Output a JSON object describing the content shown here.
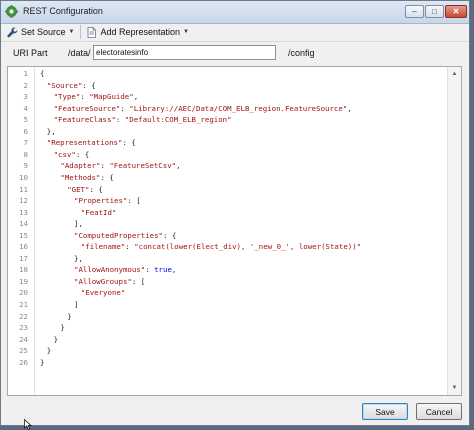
{
  "window": {
    "title": "REST Configuration",
    "controls": {
      "minimize": "–",
      "maximize": "□",
      "close": "✕"
    }
  },
  "toolbar": {
    "set_source_label": "Set Source",
    "add_representation_label": "Add Representation"
  },
  "uri": {
    "label": "URI Part",
    "prefix": "/data/",
    "value": "electoratesinfo",
    "suffix": "/config"
  },
  "editor": {
    "lines": [
      {
        "n": "1",
        "indent": 0,
        "parts": [
          {
            "t": "{",
            "c": "punc"
          }
        ]
      },
      {
        "n": "2",
        "indent": 1,
        "parts": [
          {
            "t": "\"Source\"",
            "c": "key"
          },
          {
            "t": ": {",
            "c": "punc"
          }
        ]
      },
      {
        "n": "3",
        "indent": 2,
        "parts": [
          {
            "t": "\"Type\"",
            "c": "key"
          },
          {
            "t": ": ",
            "c": "punc"
          },
          {
            "t": "\"MapGuide\"",
            "c": "str"
          },
          {
            "t": ",",
            "c": "punc"
          }
        ]
      },
      {
        "n": "4",
        "indent": 2,
        "parts": [
          {
            "t": "\"FeatureSource\"",
            "c": "key"
          },
          {
            "t": ": ",
            "c": "punc"
          },
          {
            "t": "\"Library://AEC/Data/COM_ELB_region.FeatureSource\"",
            "c": "str"
          },
          {
            "t": ",",
            "c": "punc"
          }
        ]
      },
      {
        "n": "5",
        "indent": 2,
        "parts": [
          {
            "t": "\"FeatureClass\"",
            "c": "key"
          },
          {
            "t": ": ",
            "c": "punc"
          },
          {
            "t": "\"Default:COM_ELB_region\"",
            "c": "str"
          }
        ]
      },
      {
        "n": "6",
        "indent": 1,
        "parts": [
          {
            "t": "},",
            "c": "punc"
          }
        ]
      },
      {
        "n": "7",
        "indent": 1,
        "parts": [
          {
            "t": "\"Representations\"",
            "c": "key"
          },
          {
            "t": ": {",
            "c": "punc"
          }
        ]
      },
      {
        "n": "8",
        "indent": 2,
        "parts": [
          {
            "t": "\"csv\"",
            "c": "key"
          },
          {
            "t": ": {",
            "c": "punc"
          }
        ]
      },
      {
        "n": "9",
        "indent": 3,
        "parts": [
          {
            "t": "\"Adapter\"",
            "c": "key"
          },
          {
            "t": ": ",
            "c": "punc"
          },
          {
            "t": "\"FeatureSetCsv\"",
            "c": "str"
          },
          {
            "t": ",",
            "c": "punc"
          }
        ]
      },
      {
        "n": "10",
        "indent": 3,
        "parts": [
          {
            "t": "\"Methods\"",
            "c": "key"
          },
          {
            "t": ": {",
            "c": "punc"
          }
        ]
      },
      {
        "n": "11",
        "indent": 4,
        "parts": [
          {
            "t": "\"GET\"",
            "c": "key"
          },
          {
            "t": ": {",
            "c": "punc"
          }
        ]
      },
      {
        "n": "12",
        "indent": 5,
        "parts": [
          {
            "t": "\"Properties\"",
            "c": "key"
          },
          {
            "t": ": [",
            "c": "punc"
          }
        ]
      },
      {
        "n": "13",
        "indent": 6,
        "parts": [
          {
            "t": "\"FeatId\"",
            "c": "str"
          }
        ]
      },
      {
        "n": "14",
        "indent": 5,
        "parts": [
          {
            "t": "],",
            "c": "punc"
          }
        ]
      },
      {
        "n": "15",
        "indent": 5,
        "parts": [
          {
            "t": "\"ComputedProperties\"",
            "c": "key"
          },
          {
            "t": ": {",
            "c": "punc"
          }
        ]
      },
      {
        "n": "16",
        "indent": 6,
        "parts": [
          {
            "t": "\"filename\"",
            "c": "key"
          },
          {
            "t": ": ",
            "c": "punc"
          },
          {
            "t": "\"concat(lower(Elect_div), '_new_0_', lower(State))\"",
            "c": "str"
          }
        ]
      },
      {
        "n": "17",
        "indent": 5,
        "parts": [
          {
            "t": "},",
            "c": "punc"
          }
        ]
      },
      {
        "n": "18",
        "indent": 5,
        "parts": [
          {
            "t": "\"AllowAnonymous\"",
            "c": "key"
          },
          {
            "t": ": ",
            "c": "punc"
          },
          {
            "t": "true",
            "c": "lit"
          },
          {
            "t": ",",
            "c": "punc"
          }
        ]
      },
      {
        "n": "19",
        "indent": 5,
        "parts": [
          {
            "t": "\"AllowGroups\"",
            "c": "key"
          },
          {
            "t": ": [",
            "c": "punc"
          }
        ]
      },
      {
        "n": "20",
        "indent": 6,
        "parts": [
          {
            "t": "\"Everyone\"",
            "c": "str"
          }
        ]
      },
      {
        "n": "21",
        "indent": 5,
        "parts": [
          {
            "t": "]",
            "c": "punc"
          }
        ]
      },
      {
        "n": "22",
        "indent": 4,
        "parts": [
          {
            "t": "}",
            "c": "punc"
          }
        ]
      },
      {
        "n": "23",
        "indent": 3,
        "parts": [
          {
            "t": "}",
            "c": "punc"
          }
        ]
      },
      {
        "n": "24",
        "indent": 2,
        "parts": [
          {
            "t": "}",
            "c": "punc"
          }
        ]
      },
      {
        "n": "25",
        "indent": 1,
        "parts": [
          {
            "t": "}",
            "c": "punc"
          }
        ]
      },
      {
        "n": "26",
        "indent": 0,
        "parts": [
          {
            "t": "}",
            "c": "punc"
          }
        ]
      }
    ]
  },
  "footer": {
    "save_label": "Save",
    "cancel_label": "Cancel"
  }
}
